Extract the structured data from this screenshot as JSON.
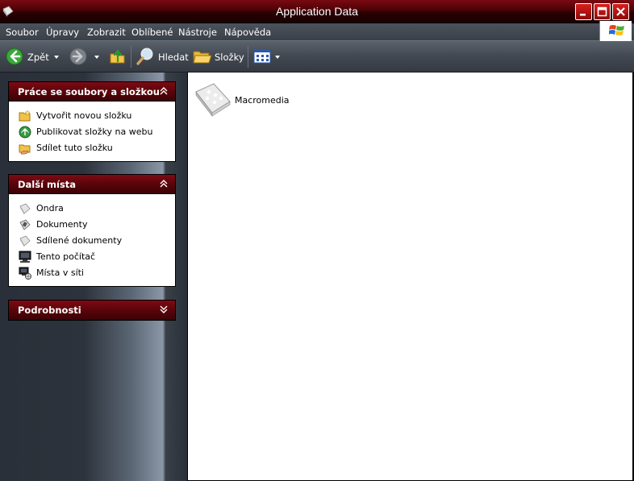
{
  "window": {
    "title": "Application Data"
  },
  "menu": {
    "items": [
      "Soubor",
      "Úpravy",
      "Zobrazit",
      "Oblíbené",
      "Nástroje",
      "Nápověda"
    ]
  },
  "toolbar": {
    "back_label": "Zpět",
    "search_label": "Hledat",
    "folders_label": "Složky"
  },
  "panels": {
    "tasks": {
      "title": "Práce se soubory a složkou",
      "items": [
        "Vytvořit novou složku",
        "Publikovat složky na webu",
        "Sdílet tuto složku"
      ]
    },
    "places": {
      "title": "Další místa",
      "items": [
        "Ondra",
        "Dokumenty",
        "Sdílené dokumenty",
        "Tento počítač",
        "Místa v síti"
      ]
    },
    "details": {
      "title": "Podrobnosti"
    }
  },
  "content": {
    "items": [
      {
        "name": "Macromedia",
        "icon": "folder-icon"
      }
    ]
  },
  "colors": {
    "titlebar": "#4a0206",
    "panel_header": "#6a0610",
    "chrome": "#424851"
  }
}
